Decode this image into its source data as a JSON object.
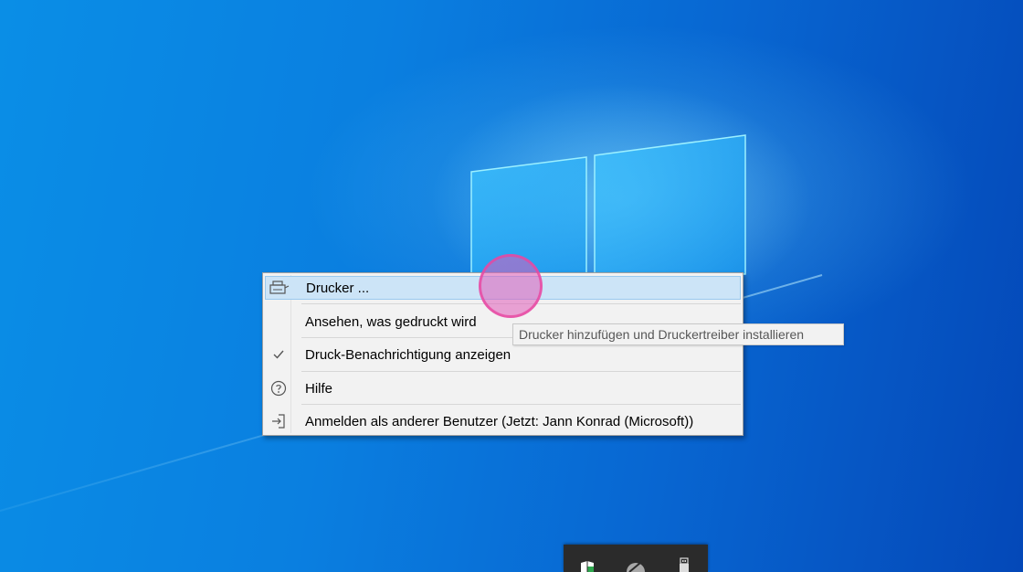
{
  "context_menu": {
    "items": [
      {
        "label": "Drucker ...",
        "icon": "printer-icon",
        "highlighted": true
      },
      {
        "label": "Ansehen, was gedruckt wird",
        "icon": ""
      },
      {
        "label": "Druck-Benachrichtigung anzeigen",
        "icon": "checkmark-icon",
        "checked": true
      },
      {
        "label": "Hilfe",
        "icon": "help-circle-icon"
      },
      {
        "label": "Anmelden als anderer Benutzer (Jetzt: Jann Konrad (Microsoft))",
        "icon": "sign-in-icon"
      }
    ]
  },
  "tooltip": {
    "text": "Drucker hinzufügen und Druckertreiber installieren"
  },
  "tray_popup": {
    "icons": [
      "windows-security-icon",
      "network-icon",
      "usb-device-icon"
    ]
  },
  "colors": {
    "desktop_blue": "#0a7fe0",
    "menu_background": "#f2f2f2",
    "menu_highlight": "#cce4f7",
    "click_indicator": "#e05cba"
  }
}
